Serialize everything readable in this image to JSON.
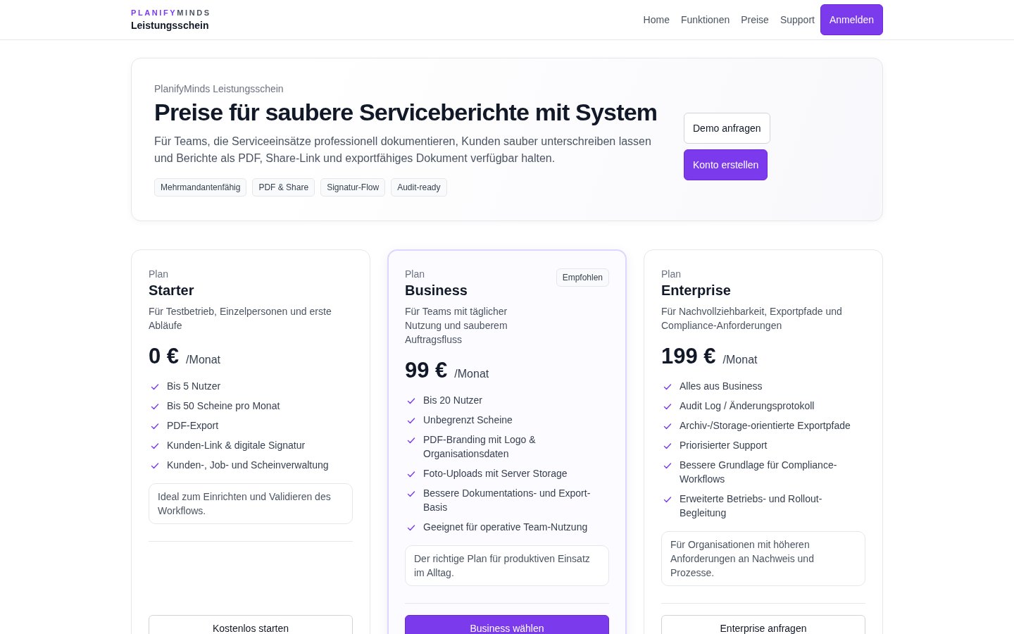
{
  "header": {
    "brand_primary": "PLANIFY",
    "brand_secondary": "MINDS",
    "product": "Leistungsschein",
    "nav": [
      {
        "label": "Home",
        "kind": "link"
      },
      {
        "label": "Funktionen",
        "kind": "link"
      },
      {
        "label": "Preise",
        "kind": "link"
      },
      {
        "label": "Support",
        "kind": "link"
      },
      {
        "label": "Anmelden",
        "kind": "button"
      }
    ]
  },
  "hero": {
    "eyebrow": "PlanifyMinds Leistungsschein",
    "title": "Preise für saubere Serviceberichte mit System",
    "description": "Für Teams, die Serviceeinsätze professionell dokumentieren, Kunden sauber unterschreiben lassen und Berichte als PDF, Share-Link und exportfähiges Dokument verfügbar halten.",
    "tags": [
      "Mehrmandantenfähig",
      "PDF & Share",
      "Signatur-Flow",
      "Audit-ready"
    ],
    "buttons": [
      {
        "label": "Demo anfragen",
        "kind": "secondary"
      },
      {
        "label": "Konto erstellen",
        "kind": "primary"
      }
    ]
  },
  "plans": [
    {
      "eyebrow": "Plan",
      "name": "Starter",
      "description": "Für Testbetrieb, Einzelpersonen und erste Abläufe",
      "price": "0 €",
      "period": "/Monat",
      "recommended": false,
      "features": [
        "Bis 5 Nutzer",
        "Bis 50 Scheine pro Monat",
        "PDF-Export",
        "Kunden-Link & digitale Signatur",
        "Kunden-, Job- und Scheinverwaltung"
      ],
      "note": "Ideal zum Einrichten und Validieren des Workflows.",
      "button": {
        "label": "Kostenlos starten",
        "kind": "secondary"
      }
    },
    {
      "eyebrow": "Plan",
      "name": "Business",
      "description": "Für Teams mit täglicher Nutzung und sauberem Auftragsfluss",
      "price": "99 €",
      "period": "/Monat",
      "recommended": true,
      "badge": "Empfohlen",
      "features": [
        "Bis 20 Nutzer",
        "Unbegrenzt Scheine",
        "PDF-Branding mit Logo & Organisationsdaten",
        "Foto-Uploads mit Server Storage",
        "Bessere Dokumentations- und Export-Basis",
        "Geeignet für operative Team-Nutzung"
      ],
      "note": "Der richtige Plan für produktiven Einsatz im Alltag.",
      "button": {
        "label": "Business wählen",
        "kind": "primary"
      }
    },
    {
      "eyebrow": "Plan",
      "name": "Enterprise",
      "description": "Für Nachvollziehbarkeit, Exportpfade und Compliance-Anforderungen",
      "price": "199 €",
      "period": "/Monat",
      "recommended": false,
      "features": [
        "Alles aus Business",
        "Audit Log / Änderungsprotokoll",
        "Archiv-/Storage-orientierte Exportpfade",
        "Priorisierter Support",
        "Bessere Grundlage für Compliance-Workflows",
        "Erweiterte Betriebs- und Rollout-Begleitung"
      ],
      "note": "Für Organisationen mit höheren Anforderungen an Nachweis und Prozesse.",
      "button": {
        "label": "Enterprise anfragen",
        "kind": "secondary"
      }
    }
  ]
}
